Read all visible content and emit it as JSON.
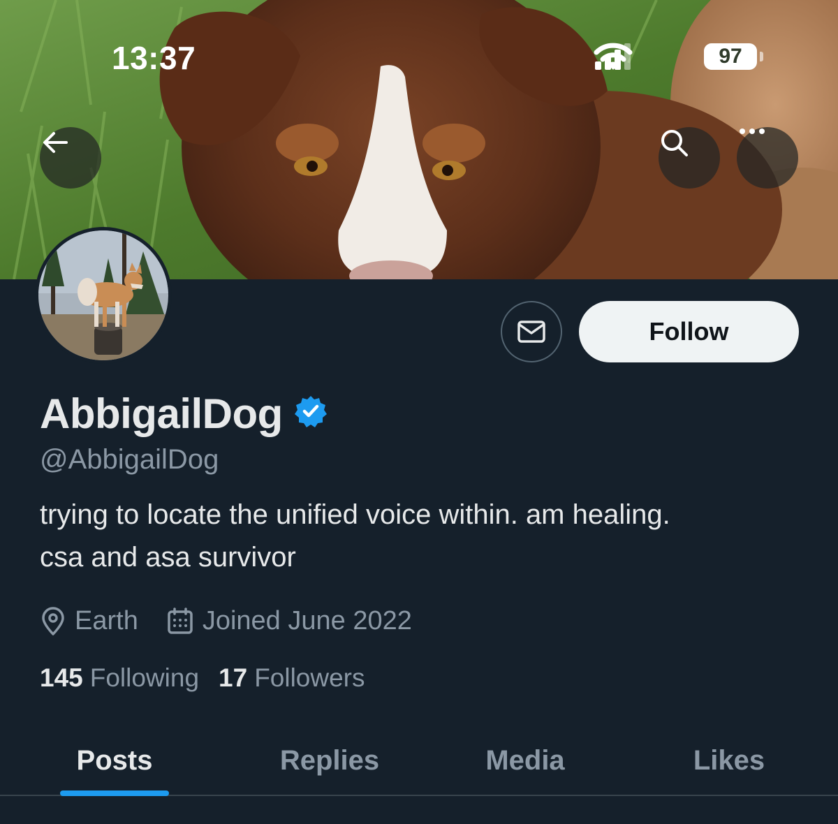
{
  "status_bar": {
    "time": "13:37",
    "battery_level": "97",
    "icons": [
      "cellular-signal-icon",
      "wifi-icon",
      "battery-icon"
    ]
  },
  "banner": {
    "image": "dog-banner-photo",
    "buttons": [
      "back-arrow-icon",
      "search-icon",
      "more-icon"
    ]
  },
  "profile": {
    "avatar": "dog-avatar-photo",
    "display_name": "AbbigailDog",
    "verified": true,
    "handle": "@AbbigailDog",
    "bio_line1": "trying to locate the unified voice within. am healing.",
    "bio_line2": "csa and asa survivor",
    "location": "Earth",
    "joined": "Joined June 2022",
    "following_count": "145",
    "following_label": "Following",
    "followers_count": "17",
    "followers_label": "Followers"
  },
  "actions": {
    "message_icon": "envelope-icon",
    "follow_label": "Follow"
  },
  "tabs": [
    {
      "label": "Posts",
      "active": true
    },
    {
      "label": "Replies",
      "active": false
    },
    {
      "label": "Media",
      "active": false
    },
    {
      "label": "Likes",
      "active": false
    }
  ],
  "colors": {
    "background": "#15202b",
    "accent": "#1d9bf0",
    "secondary_text": "#8b98a5",
    "verified_badge": "#1d9bf0",
    "follow_button_bg": "#eff3f4"
  }
}
